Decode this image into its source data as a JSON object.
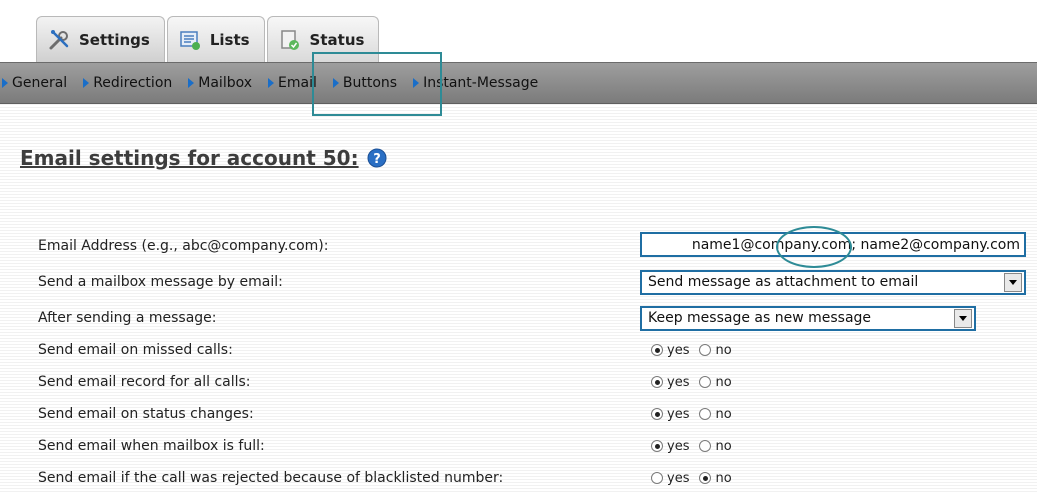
{
  "tabs": [
    {
      "label": "Settings",
      "icon": "tools-icon",
      "active": true
    },
    {
      "label": "Lists",
      "icon": "list-icon",
      "active": false
    },
    {
      "label": "Status",
      "icon": "status-icon",
      "active": false
    }
  ],
  "subnav": [
    {
      "label": "General"
    },
    {
      "label": "Redirection"
    },
    {
      "label": "Mailbox"
    },
    {
      "label": "Email"
    },
    {
      "label": "Buttons"
    },
    {
      "label": "Instant-Message"
    }
  ],
  "page": {
    "title": "Email settings for account 50:"
  },
  "form": {
    "email_address": {
      "label": "Email Address (e.g., abc@company.com):",
      "value": "name1@company.com; name2@company.com"
    },
    "send_mailbox_message": {
      "label": "Send a mailbox message by email:",
      "selected": "Send message as attachment to email"
    },
    "after_sending": {
      "label": "After sending a message:",
      "selected": "Keep message as new message"
    },
    "radios": [
      {
        "label": "Send email on missed calls:",
        "yes_label": "yes",
        "no_label": "no",
        "value": "yes"
      },
      {
        "label": "Send email record for all calls:",
        "yes_label": "yes",
        "no_label": "no",
        "value": "yes"
      },
      {
        "label": "Send email on status changes:",
        "yes_label": "yes",
        "no_label": "no",
        "value": "yes"
      },
      {
        "label": "Send email when mailbox is full:",
        "yes_label": "yes",
        "no_label": "no",
        "value": "yes"
      },
      {
        "label": "Send email if the call was rejected because of blacklisted number:",
        "yes_label": "yes",
        "no_label": "no",
        "value": "no"
      }
    ]
  },
  "colors": {
    "accent_highlight": "#2e8b96",
    "nav_arrow": "#1a6ec8",
    "input_border": "#1f6ea3"
  }
}
